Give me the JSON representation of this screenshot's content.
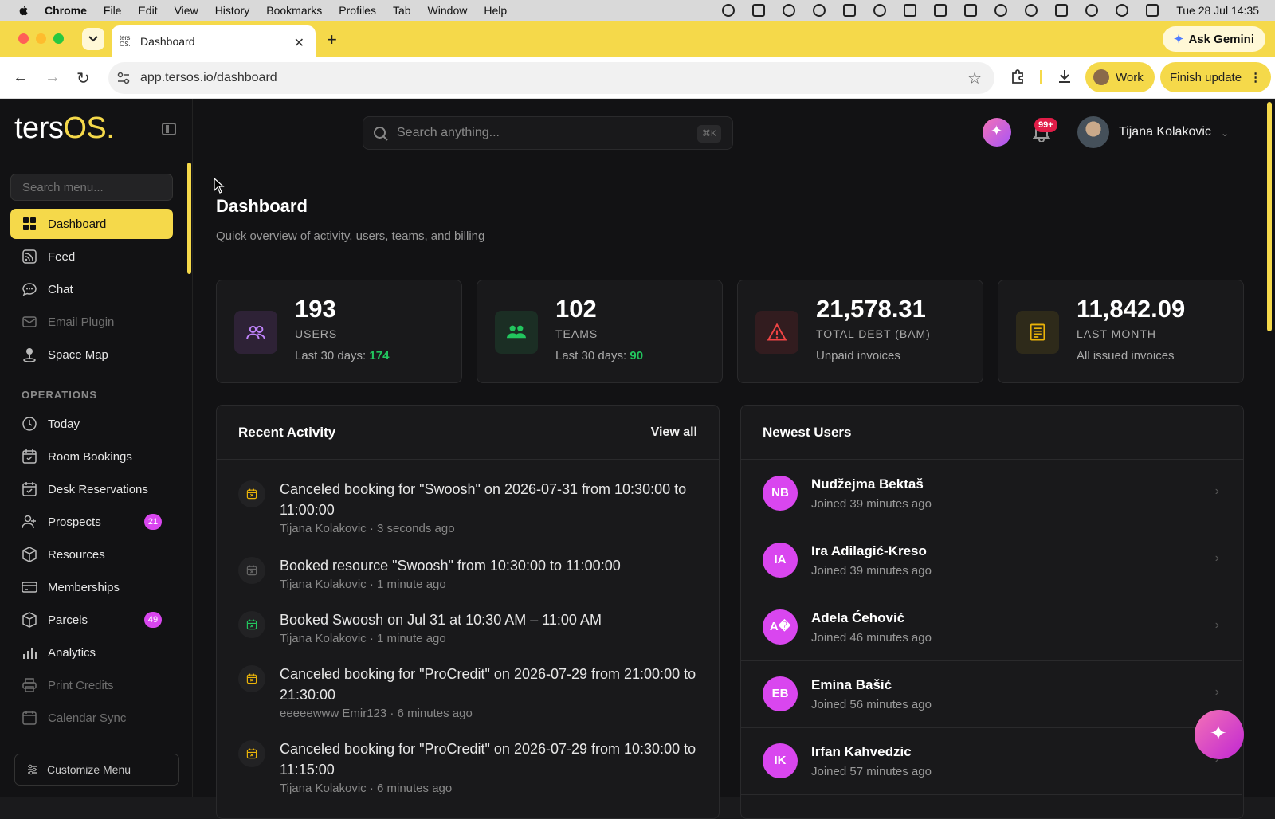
{
  "menubar": {
    "app": "Chrome",
    "items": [
      "File",
      "Edit",
      "View",
      "History",
      "Bookmarks",
      "Profiles",
      "Tab",
      "Window",
      "Help"
    ],
    "clock": "Tue 28 Jul  14:35"
  },
  "browser": {
    "tab_title": "Dashboard",
    "url": "app.tersos.io/dashboard",
    "ask_gemini": "Ask Gemini",
    "profile": "Work",
    "finish_update": "Finish update"
  },
  "sidebar": {
    "logo_main": "ters",
    "logo_accent": "OS.",
    "search_placeholder": "Search menu...",
    "items_top": [
      {
        "label": "Dashboard",
        "icon": "dashboard-icon",
        "active": true
      },
      {
        "label": "Feed",
        "icon": "rss-icon"
      },
      {
        "label": "Chat",
        "icon": "chat-icon"
      },
      {
        "label": "Email Plugin",
        "icon": "email-icon",
        "dim": true
      },
      {
        "label": "Space Map",
        "icon": "map-pin-icon"
      }
    ],
    "section_label": "OPERATIONS",
    "items_ops": [
      {
        "label": "Today",
        "icon": "clock-icon"
      },
      {
        "label": "Room Bookings",
        "icon": "calendar-check-icon"
      },
      {
        "label": "Desk Reservations",
        "icon": "calendar-check-icon"
      },
      {
        "label": "Prospects",
        "icon": "user-plus-icon",
        "badge": "21"
      },
      {
        "label": "Resources",
        "icon": "box-icon"
      },
      {
        "label": "Memberships",
        "icon": "card-icon"
      },
      {
        "label": "Parcels",
        "icon": "box-icon",
        "badge": "49"
      },
      {
        "label": "Analytics",
        "icon": "bar-chart-icon"
      },
      {
        "label": "Print Credits",
        "icon": "printer-icon",
        "dim": true
      },
      {
        "label": "Calendar Sync",
        "icon": "calendar-icon",
        "dim": true
      }
    ],
    "customize": "Customize Menu"
  },
  "header": {
    "search_placeholder": "Search anything...",
    "shortcut": "⌘K",
    "notif_count": "99+",
    "user_name": "Tijana Kolakovic"
  },
  "page": {
    "title": "Dashboard",
    "subtitle": "Quick overview of activity, users, teams, and billing"
  },
  "stats": [
    {
      "value": "193",
      "label": "USERS",
      "sub_prefix": "Last 30 days: ",
      "sub_num": "174",
      "icon": "users-icon",
      "color": "#c084fc",
      "bg": "#2e2236"
    },
    {
      "value": "102",
      "label": "TEAMS",
      "sub_prefix": "Last 30 days: ",
      "sub_num": "90",
      "icon": "team-icon",
      "color": "#22c55e",
      "bg": "#1b2e24"
    },
    {
      "value": "21,578.31",
      "label": "TOTAL DEBT (BAM)",
      "sub_prefix": "Unpaid invoices",
      "sub_num": "",
      "icon": "alert-icon",
      "color": "#ef4444",
      "bg": "#321c1f"
    },
    {
      "value": "11,842.09",
      "label": "LAST MONTH",
      "sub_prefix": "All issued invoices",
      "sub_num": "",
      "icon": "invoice-icon",
      "color": "#eab308",
      "bg": "#2e2a1a"
    }
  ],
  "activity": {
    "title": "Recent Activity",
    "view_all": "View all",
    "items": [
      {
        "text": "Canceled booking for \"Swoosh\" on 2026-07-31 from 10:30:00 to 11:00:00",
        "meta": "Tijana Kolakovic · 3 seconds ago",
        "icon_color": "#eab308"
      },
      {
        "text": "Booked resource \"Swoosh\" from 10:30:00 to 11:00:00",
        "meta": "Tijana Kolakovic · 1 minute ago",
        "icon_color": "#666666"
      },
      {
        "text": "Booked Swoosh on Jul 31 at 10:30 AM – 11:00 AM",
        "meta": "Tijana Kolakovic · 1 minute ago",
        "icon_color": "#22c55e"
      },
      {
        "text": "Canceled booking for \"ProCredit\" on 2026-07-29 from 21:00:00 to 21:30:00",
        "meta": "eeeeewww Emir123 · 6 minutes ago",
        "icon_color": "#eab308"
      },
      {
        "text": "Canceled booking for \"ProCredit\" on 2026-07-29 from 10:30:00 to 11:15:00",
        "meta": "Tijana Kolakovic · 6 minutes ago",
        "icon_color": "#eab308"
      }
    ]
  },
  "newest_users": {
    "title": "Newest Users",
    "items": [
      {
        "initials": "NB",
        "name": "Nudžejma Bektaš",
        "joined": "Joined 39 minutes ago"
      },
      {
        "initials": "IA",
        "name": "Ira Adilagić-Kreso",
        "joined": "Joined 39 minutes ago"
      },
      {
        "initials": "A�",
        "name": "Adela Ćehović",
        "joined": "Joined 46 minutes ago"
      },
      {
        "initials": "EB",
        "name": "Emina Bašić",
        "joined": "Joined 56 minutes ago"
      },
      {
        "initials": "IK",
        "name": "Irfan Kahvedzic",
        "joined": "Joined 57 minutes ago"
      }
    ]
  }
}
